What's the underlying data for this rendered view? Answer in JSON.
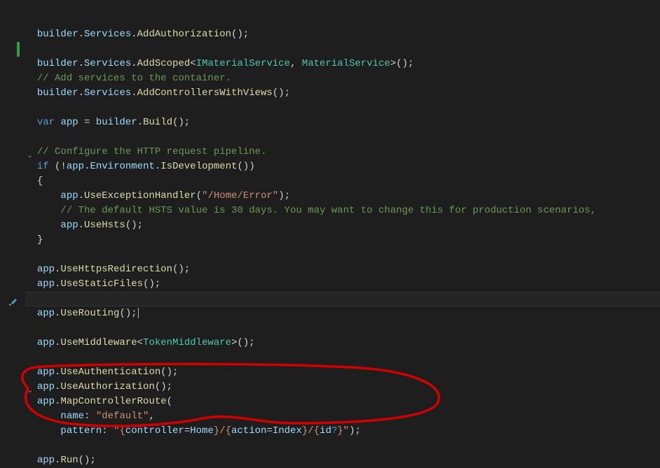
{
  "lines": {
    "l1": {
      "builder": "builder",
      "dot1": ".",
      "services": "Services",
      "dot2": ".",
      "addauth": "AddAuthorization",
      "paren": "();"
    },
    "l3": {
      "builder": "builder",
      "dot1": ".",
      "services": "Services",
      "dot2": ".",
      "addscoped": "AddScoped",
      "lt": "<",
      "imat": "IMaterialService",
      "comma": ", ",
      "mat": "MaterialService",
      "gt": ">();"
    },
    "l4": {
      "cmt": "// Add services to the container."
    },
    "l5": {
      "builder": "builder",
      "dot1": ".",
      "services": "Services",
      "dot2": ".",
      "addctrl": "AddControllersWithViews",
      "paren": "();"
    },
    "l7": {
      "var": "var",
      "sp": " ",
      "app": "app",
      "eq": " = ",
      "builder": "builder",
      "dot": ".",
      "build": "Build",
      "paren": "();"
    },
    "l9": {
      "cmt": "// Configure the HTTP request pipeline."
    },
    "l10": {
      "if": "if",
      "sp": " (!",
      "app": "app",
      "dot": ".",
      "env": "Environment",
      "dot2": ".",
      "isdev": "IsDevelopment",
      "paren": "())"
    },
    "l11": {
      "brace": "{"
    },
    "l12": {
      "app": "app",
      "dot": ".",
      "useexc": "UseExceptionHandler",
      "open": "(",
      "str": "\"/Home/Error\"",
      "close": ");"
    },
    "l13": {
      "cmt": "// The default HSTS value is 30 days. You may want to change this for production scenarios,"
    },
    "l14": {
      "app": "app",
      "dot": ".",
      "usehsts": "UseHsts",
      "paren": "();"
    },
    "l15": {
      "brace": "}"
    },
    "l17": {
      "app": "app",
      "dot": ".",
      "fn": "UseHttpsRedirection",
      "paren": "();"
    },
    "l18": {
      "app": "app",
      "dot": ".",
      "fn": "UseStaticFiles",
      "paren": "();"
    },
    "l20": {
      "app": "app",
      "dot": ".",
      "fn": "UseRouting",
      "paren": "();"
    },
    "l22": {
      "app": "app",
      "dot": ".",
      "fn": "UseMiddleware",
      "lt": "<",
      "type": "TokenMiddleware",
      "gt": ">();"
    },
    "l24": {
      "app": "app",
      "dot": ".",
      "fn": "UseAuthentication",
      "paren": "();"
    },
    "l25": {
      "app": "app",
      "dot": ".",
      "fn": "UseAuthorization",
      "paren": "();"
    },
    "l26": {
      "app": "app",
      "dot": ".",
      "fn": "MapControllerRoute",
      "paren": "("
    },
    "l27": {
      "name": "name",
      "colon": ": ",
      "str": "\"default\"",
      "comma": ","
    },
    "l28": {
      "pattern": "pattern",
      "colon": ": ",
      "q1": "\"",
      "b1": "{",
      "ctrl": "controller",
      "eq1": "=",
      "home": "Home",
      "b2": "}",
      "slash1": "/",
      "b3": "{",
      "action": "action",
      "eq2": "=",
      "index": "Index",
      "b4": "}",
      "slash2": "/",
      "b5": "{",
      "id": "id",
      "opt": "?",
      "b6": "}",
      "q2": "\"",
      "close": ");"
    },
    "l30": {
      "app": "app",
      "dot": ".",
      "fn": "Run",
      "paren": "();"
    }
  },
  "fold_glyph": "⌄"
}
